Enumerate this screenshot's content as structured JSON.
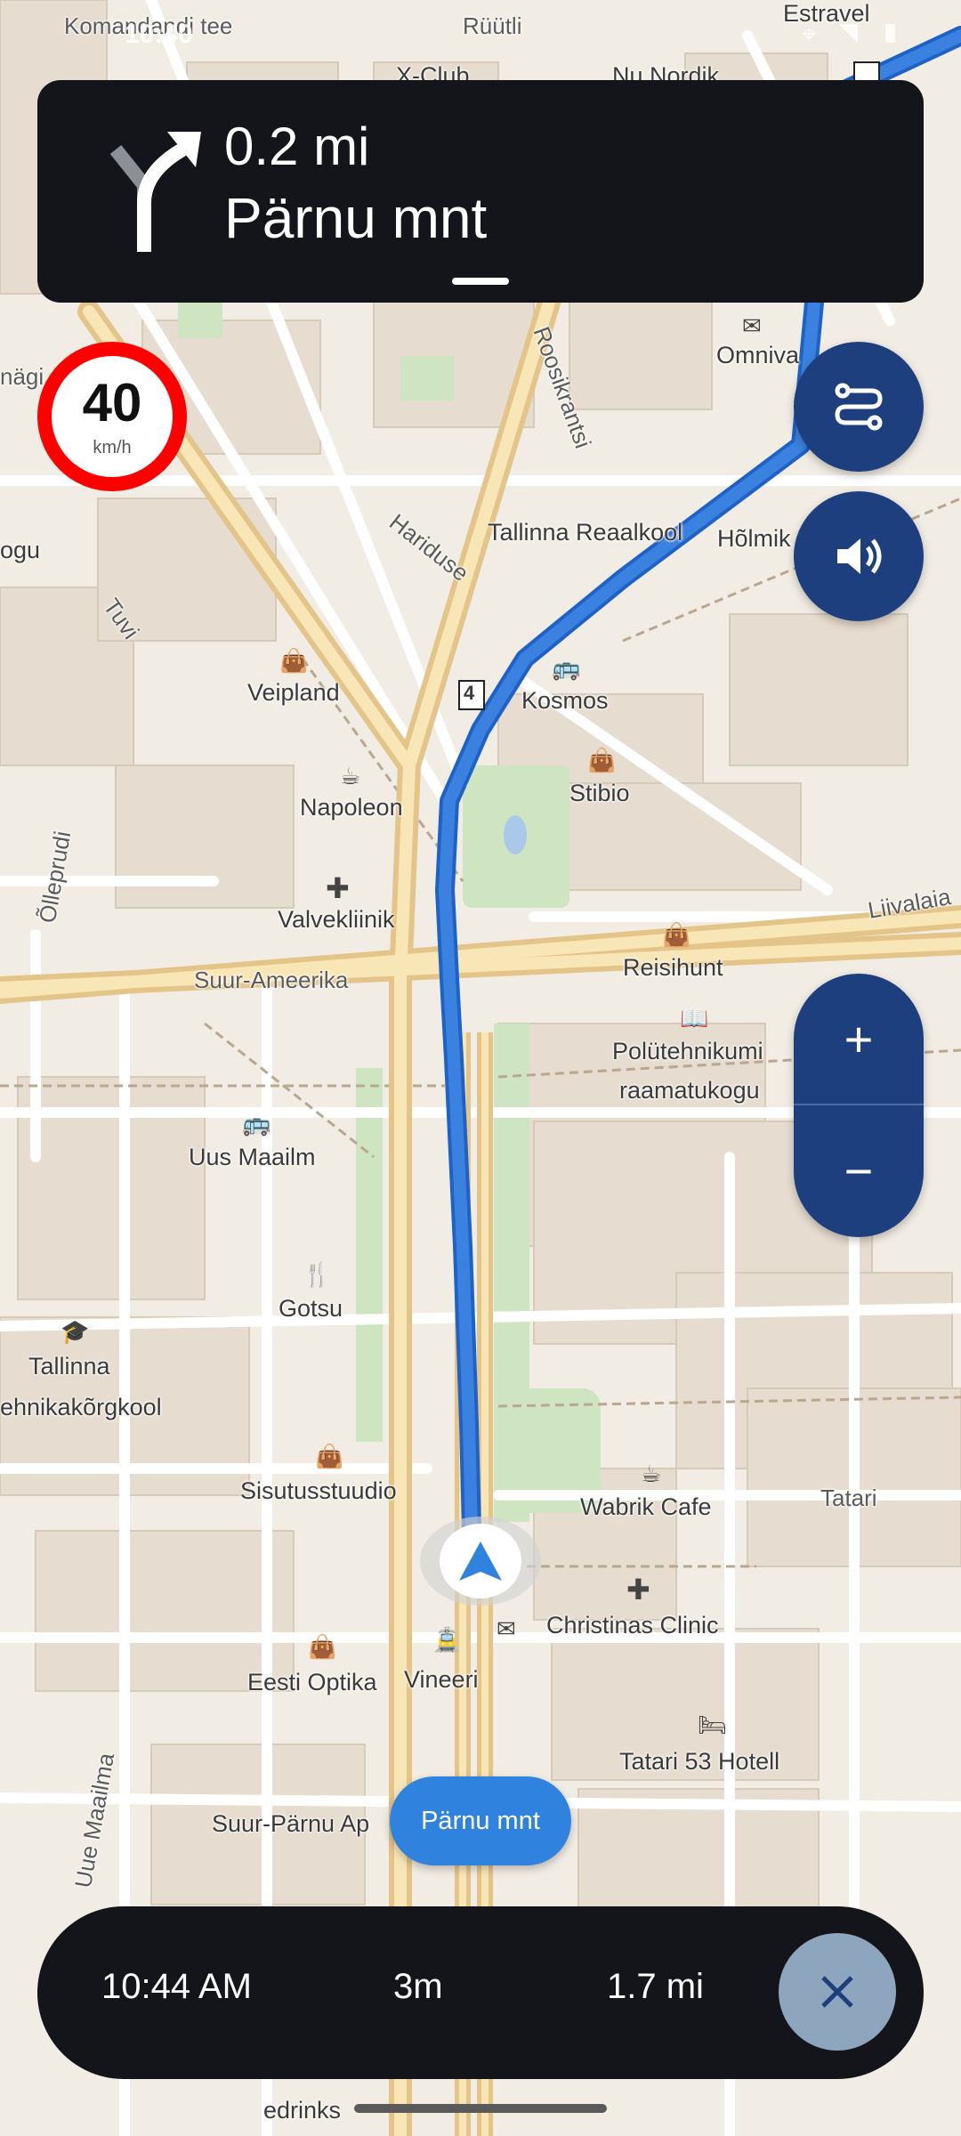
{
  "status_bar": {
    "time": "10:40",
    "icons": [
      "message-icon",
      "location-icon",
      "wifi-icon",
      "battery-icon"
    ]
  },
  "navigation": {
    "distance": "0.2 mi",
    "street": "Pärnu mnt",
    "maneuver_icon": "turn-slight-right-icon"
  },
  "speed_limit": {
    "value": "40",
    "unit": "km/h"
  },
  "map": {
    "labels": [
      {
        "text": "Komandandi tee",
        "kind": "street"
      },
      {
        "text": "Rüütli",
        "kind": "street"
      },
      {
        "text": "X-Club",
        "kind": "poi"
      },
      {
        "text": "Nu Nordik",
        "kind": "poi"
      },
      {
        "text": "Estravel",
        "kind": "poi"
      },
      {
        "text": "Omniva",
        "kind": "poi"
      },
      {
        "text": "Roosikrantsi",
        "kind": "street"
      },
      {
        "text": "Hariduse",
        "kind": "street"
      },
      {
        "text": "Tallinna Reaalkool",
        "kind": "poi"
      },
      {
        "text": "Hõlmik",
        "kind": "poi"
      },
      {
        "text": "Tuvi",
        "kind": "street"
      },
      {
        "text": "Veipland",
        "kind": "poi"
      },
      {
        "text": "Kosmos",
        "kind": "poi"
      },
      {
        "text": "Stibio",
        "kind": "poi"
      },
      {
        "text": "Napoleon",
        "kind": "poi"
      },
      {
        "text": "Õlleprudi",
        "kind": "street"
      },
      {
        "text": "Valvekliinik",
        "kind": "poi"
      },
      {
        "text": "Liivalaia",
        "kind": "street"
      },
      {
        "text": "Reisihunt",
        "kind": "poi"
      },
      {
        "text": "Suur-Ameerika",
        "kind": "street"
      },
      {
        "text": "Polütehnikumi",
        "kind": "poi"
      },
      {
        "text": "raamatukogu",
        "kind": "poi"
      },
      {
        "text": "Uus Maailm",
        "kind": "poi"
      },
      {
        "text": "Gotsu",
        "kind": "poi"
      },
      {
        "text": "Tallinna",
        "kind": "poi"
      },
      {
        "text": "ehnikakõrgkool",
        "kind": "poi"
      },
      {
        "text": "Sisutusstuudio",
        "kind": "poi"
      },
      {
        "text": "Wabrik Cafe",
        "kind": "poi"
      },
      {
        "text": "Tatari",
        "kind": "street"
      },
      {
        "text": "Christinas Clinic",
        "kind": "poi"
      },
      {
        "text": "Eesti Optika",
        "kind": "poi"
      },
      {
        "text": "Vineeri",
        "kind": "poi"
      },
      {
        "text": "Tatari 53 Hotell",
        "kind": "poi"
      },
      {
        "text": "Suur-Pärnu Ap",
        "kind": "poi"
      },
      {
        "text": "Uue Maailma",
        "kind": "street"
      },
      {
        "text": "edrinks",
        "kind": "poi"
      },
      {
        "text": "ogu",
        "kind": "poi"
      },
      {
        "text": "nägi",
        "kind": "street"
      },
      {
        "text": "4",
        "kind": "route-shield"
      }
    ],
    "route_color": "#3b82e0",
    "current_street_chip": "Pärnu mnt"
  },
  "controls": {
    "route_options_icon": "route-options-icon",
    "sound_icon": "volume-icon",
    "zoom_in": "+",
    "zoom_out": "−"
  },
  "trip": {
    "eta": "10:44 AM",
    "duration": "3m",
    "distance": "1.7 mi",
    "close_icon": "close-icon"
  }
}
